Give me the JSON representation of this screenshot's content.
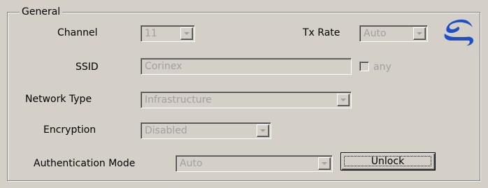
{
  "group": {
    "title": "General"
  },
  "fields": {
    "channel": {
      "label": "Channel",
      "value": "11"
    },
    "tx_rate": {
      "label": "Tx Rate",
      "value": "Auto"
    },
    "ssid": {
      "label": "SSID",
      "value": "Corinex"
    },
    "any": {
      "label": "any",
      "checked": false
    },
    "network_type": {
      "label": "Network Type",
      "value": "Infrastructure"
    },
    "encryption": {
      "label": "Encryption",
      "value": "Disabled"
    },
    "auth_mode": {
      "label": "Authentication Mode",
      "value": "Auto"
    }
  },
  "buttons": {
    "unlock": "Unlock"
  },
  "logo": {
    "icon": "corinex-logo-icon",
    "color": "#1f4fc8"
  },
  "colors": {
    "background": "#d4d0c8",
    "disabled_text": "#a0a0a0"
  }
}
